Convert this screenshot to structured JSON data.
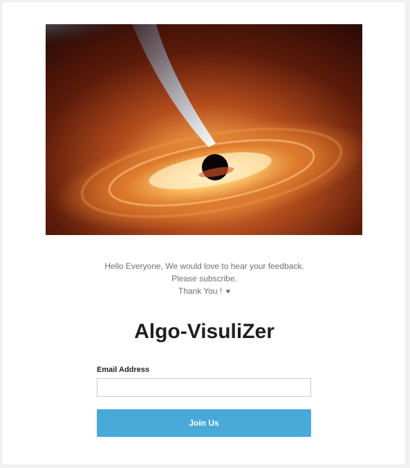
{
  "newsletter": {
    "hero_image": "black-hole-accretion-disk-image",
    "message": {
      "line1": "Hello Everyone, We would love to hear your feedback.",
      "line2": "Please subscribe.",
      "line3": "Thank You !",
      "heart_icon": "heart-icon"
    },
    "title": "Algo-VisuliZer",
    "email_label": "Email Address",
    "email_value": "",
    "email_placeholder": "",
    "button_label": "Join Us"
  },
  "colors": {
    "button": "#49a9d9",
    "text_muted": "#6f6f6f",
    "title": "#1f1f1f",
    "border": "#c9c9c9"
  }
}
